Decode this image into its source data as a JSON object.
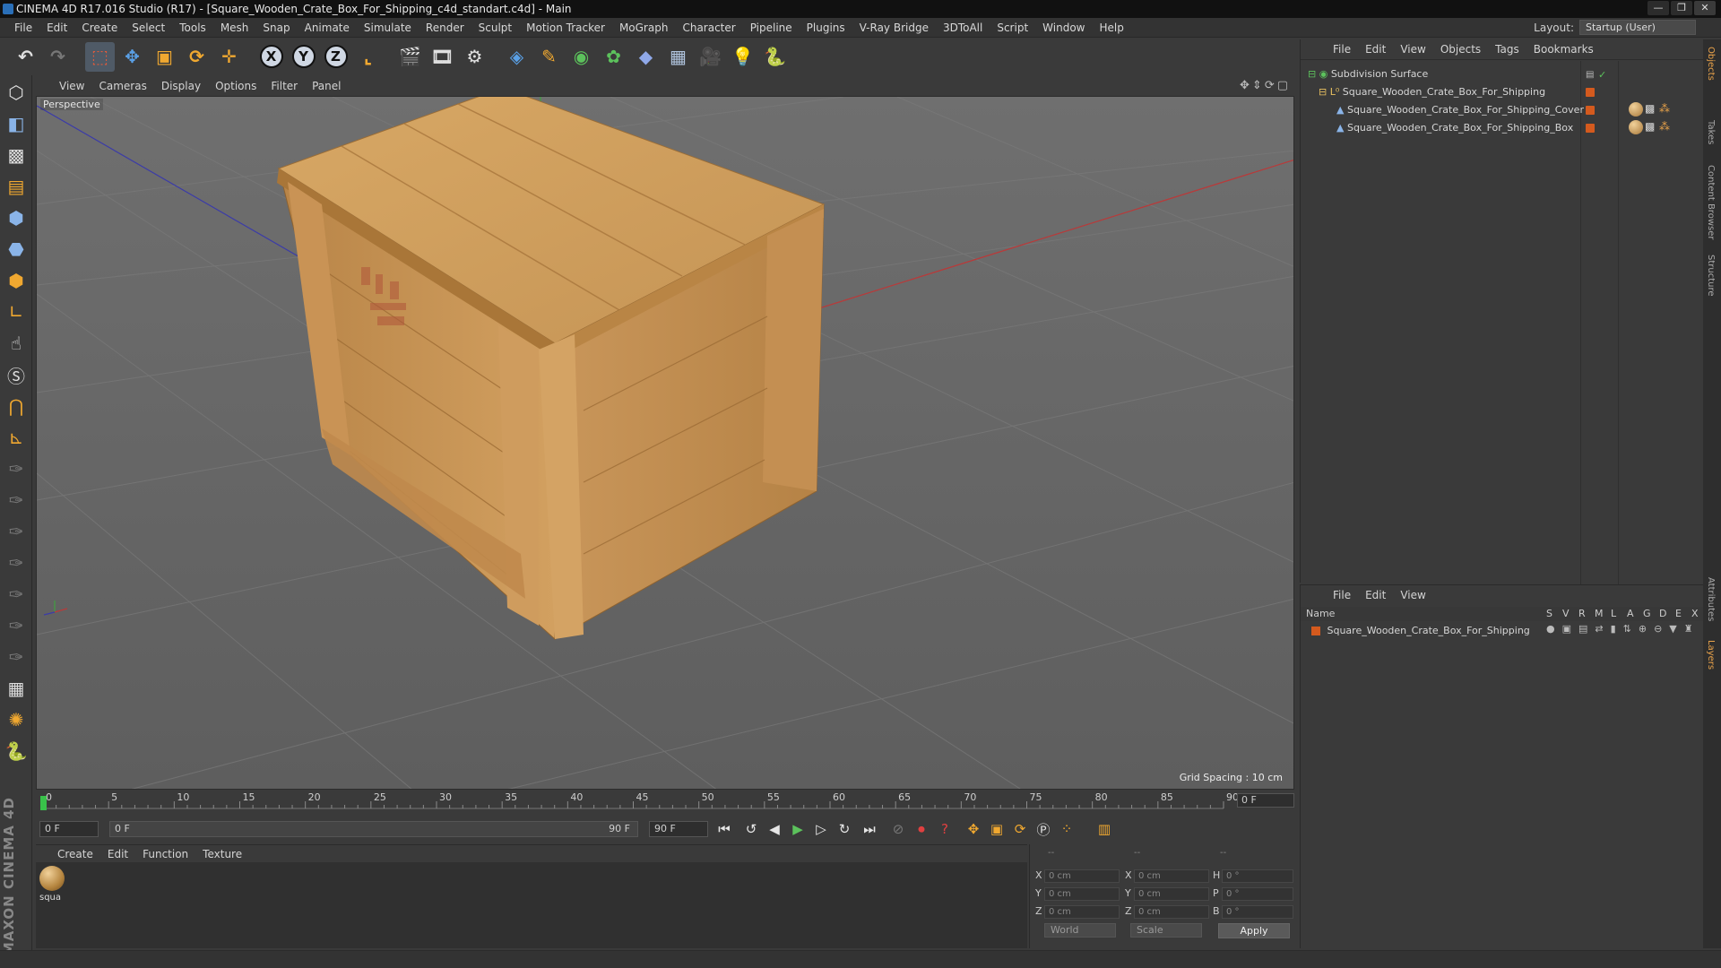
{
  "window": {
    "title": "CINEMA 4D R17.016 Studio (R17) - [Square_Wooden_Crate_Box_For_Shipping_c4d_standart.c4d] - Main",
    "buttons": [
      "—",
      "❐",
      "✕"
    ]
  },
  "menubar": {
    "items": [
      "File",
      "Edit",
      "Create",
      "Select",
      "Tools",
      "Mesh",
      "Snap",
      "Animate",
      "Simulate",
      "Render",
      "Sculpt",
      "Motion Tracker",
      "MoGraph",
      "Character",
      "Pipeline",
      "Plugins",
      "V-Ray Bridge",
      "3DToAll",
      "Script",
      "Window",
      "Help"
    ],
    "layout_label": "Layout:",
    "layout_value": "Startup (User)"
  },
  "toolbar": {
    "icons": [
      "undo-icon",
      "redo-icon",
      "live-selection-icon",
      "move-icon",
      "scale-icon",
      "rotate-icon",
      "axis-icon",
      "x-axis-lock-icon",
      "y-axis-lock-icon",
      "z-axis-lock-icon",
      "coordinate-system-icon",
      "render-view-icon",
      "render-picture-viewer-icon",
      "render-settings-icon",
      "cube-icon",
      "pen-spline-icon",
      "subdivision-icon",
      "array-icon",
      "deformer-icon",
      "floor-icon",
      "camera-icon",
      "light-icon",
      "python-icon"
    ],
    "axis_labels": [
      "X",
      "Y",
      "Z"
    ]
  },
  "viewport": {
    "menu": [
      "View",
      "Cameras",
      "Display",
      "Options",
      "Filter",
      "Panel"
    ],
    "label": "Perspective",
    "grid_spacing": "Grid Spacing : 10 cm"
  },
  "timeline": {
    "ticks": [
      "0",
      "5",
      "10",
      "15",
      "20",
      "25",
      "30",
      "35",
      "40",
      "45",
      "50",
      "55",
      "60",
      "65",
      "70",
      "75",
      "80",
      "85",
      "90"
    ],
    "current_frame": "0 F"
  },
  "transport": {
    "start_field": "0 F",
    "range_start": "0 F",
    "range_end": "90 F",
    "end_field": "90 F"
  },
  "material_manager": {
    "menu": [
      "Create",
      "Edit",
      "Function",
      "Texture"
    ],
    "materials": [
      {
        "label": "squa"
      }
    ]
  },
  "coordinates": {
    "header": [
      "--",
      "--",
      "--"
    ],
    "rows": [
      {
        "axis": "X",
        "pos": "0 cm",
        "size_axis": "X",
        "size": "0 cm",
        "rot_axis": "H",
        "rot": "0 °"
      },
      {
        "axis": "Y",
        "pos": "0 cm",
        "size_axis": "Y",
        "size": "0 cm",
        "rot_axis": "P",
        "rot": "0 °"
      },
      {
        "axis": "Z",
        "pos": "0 cm",
        "size_axis": "Z",
        "size": "0 cm",
        "rot_axis": "B",
        "rot": "0 °"
      }
    ],
    "mode_world": "World",
    "mode_scale": "Scale",
    "apply": "Apply"
  },
  "object_manager": {
    "menu": [
      "File",
      "Edit",
      "View",
      "Objects",
      "Tags",
      "Bookmarks"
    ],
    "objects": [
      {
        "name": "Subdivision Surface"
      },
      {
        "name": "Square_Wooden_Crate_Box_For_Shipping"
      },
      {
        "name": "Square_Wooden_Crate_Box_For_Shipping_Cover"
      },
      {
        "name": "Square_Wooden_Crate_Box_For_Shipping_Box"
      }
    ]
  },
  "layer_manager": {
    "menu": [
      "File",
      "Edit",
      "View"
    ],
    "header_name": "Name",
    "header_cols": [
      "S",
      "V",
      "R",
      "M",
      "L",
      "A",
      "G",
      "D",
      "E",
      "X"
    ],
    "layers": [
      {
        "name": "Square_Wooden_Crate_Box_For_Shipping",
        "color": "#d45a1e"
      }
    ]
  },
  "right_tabs": [
    "Objects",
    "Takes",
    "Content Browser",
    "Structure",
    "Attributes",
    "Layers"
  ],
  "branding": "MAXON CINEMA 4D",
  "colors": {
    "accent": "#e8a24a",
    "layer_color": "#d45a1e",
    "wood_light": "#d9a762",
    "wood_mid": "#c08d4f",
    "wood_dark": "#9c6d35"
  }
}
